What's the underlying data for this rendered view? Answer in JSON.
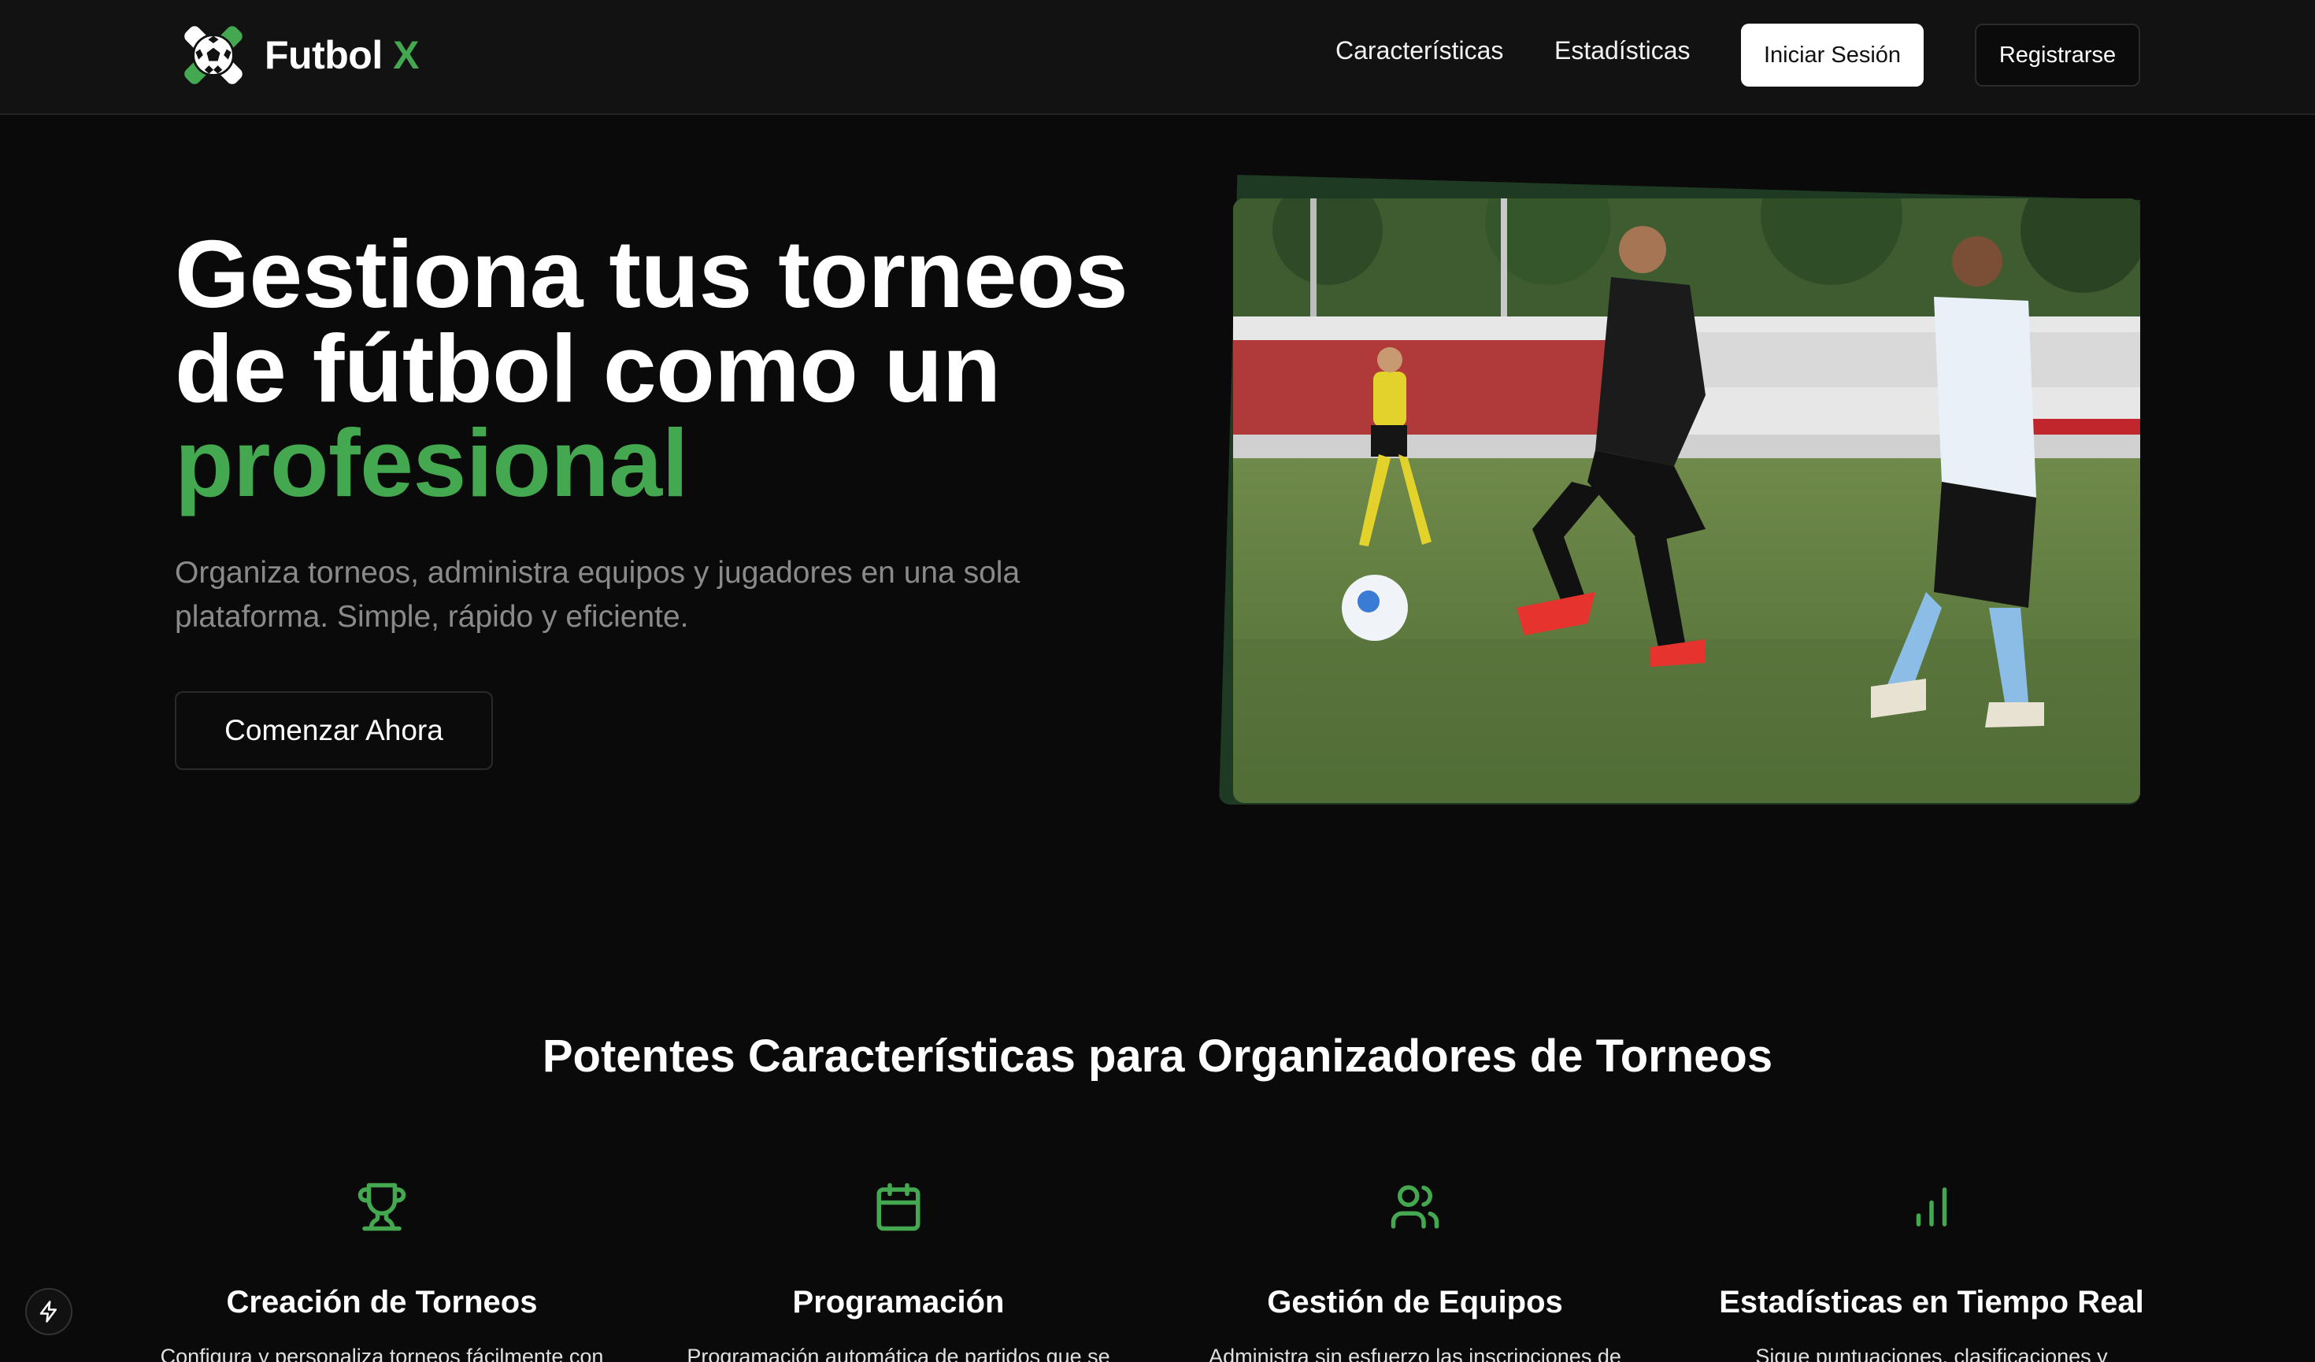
{
  "colors": {
    "accent": "#43a84f",
    "background": "#0a0a0a",
    "nav_background": "#121212",
    "muted_text": "#8a8a8a"
  },
  "nav": {
    "brand_main": "Futbol",
    "brand_x": "X",
    "links": [
      "Características",
      "Estadísticas"
    ],
    "login_label": "Iniciar Sesión",
    "register_label": "Registrarse",
    "logo_icon": "soccer-ball-logo-icon"
  },
  "hero": {
    "title_line1": "Gestiona tus torneos",
    "title_line2": "de fútbol como un",
    "title_highlight": "profesional",
    "subtitle": "Organiza torneos, administra equipos y jugadores en una sola plataforma. Simple, rápido y eficiente.",
    "cta_label": "Comenzar Ahora",
    "image_icon": "soccer-match-photo"
  },
  "features": {
    "section_title": "Potentes Características para Organizadores de Torneos",
    "items": [
      {
        "icon": "trophy-icon",
        "title": "Creación de Torneos",
        "description": "Configura y personaliza torneos fácilmente con"
      },
      {
        "icon": "calendar-icon",
        "title": "Programación",
        "description": "Programación automática de partidos que se"
      },
      {
        "icon": "users-icon",
        "title": "Gestión de Equipos",
        "description": "Administra sin esfuerzo las inscripciones de"
      },
      {
        "icon": "bar-chart-icon",
        "title": "Estadísticas en Tiempo Real",
        "description": "Sigue puntuaciones, clasificaciones y"
      }
    ]
  },
  "dev_badge_icon": "lightning-icon"
}
